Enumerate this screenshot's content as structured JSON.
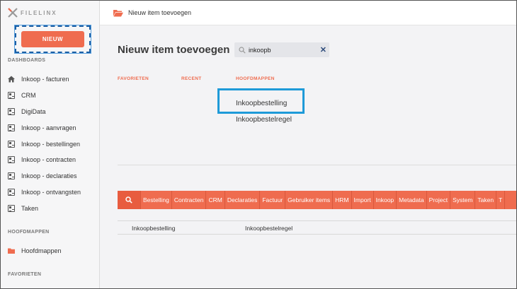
{
  "app": {
    "logo_text": "FILELINX"
  },
  "topbar": {
    "title": "Nieuw item toevoegen"
  },
  "sidebar": {
    "new_button": "NIEUW",
    "dashboards_label": "DASHBOARDS",
    "dashboards": [
      {
        "label": "Inkoop - facturen",
        "icon": "home-icon"
      },
      {
        "label": "CRM",
        "icon": "dashboard-icon"
      },
      {
        "label": "DigiData",
        "icon": "dashboard-icon"
      },
      {
        "label": "Inkoop - aanvragen",
        "icon": "dashboard-icon"
      },
      {
        "label": "Inkoop - bestellingen",
        "icon": "dashboard-icon"
      },
      {
        "label": "Inkoop - contracten",
        "icon": "dashboard-icon"
      },
      {
        "label": "Inkoop - declaraties",
        "icon": "dashboard-icon"
      },
      {
        "label": "Inkoop - ontvangsten",
        "icon": "dashboard-icon"
      },
      {
        "label": "Taken",
        "icon": "dashboard-icon"
      }
    ],
    "hoofdmappen_label": "HOOFDMAPPEN",
    "hoofdmappen_item": "Hoofdmappen",
    "favorieten_label": "FAVORIETEN"
  },
  "main": {
    "title": "Nieuw item toevoegen",
    "search": {
      "value": "inkoopb",
      "placeholder": ""
    },
    "tabs": [
      "FAVORIETEN",
      "RECENT",
      "HOOFDMAPPEN"
    ],
    "results": [
      "Inkoopbestelling",
      "Inkoopbestelregel"
    ],
    "filters": [
      "Bestelling",
      "Contracten",
      "CRM",
      "Declaraties",
      "Factuur",
      "Gebruiker items",
      "HRM",
      "Import",
      "Inkoop",
      "Metadata",
      "Project",
      "System",
      "Taken",
      "T"
    ],
    "table_row": [
      "Inkoopbestelling",
      "Inkoopbestelregel"
    ]
  },
  "colors": {
    "accent": "#ef6c4f",
    "highlight": "#1e9ad8",
    "sidebar_bg": "#f6f6f7",
    "main_bg": "#f3f3f5"
  }
}
